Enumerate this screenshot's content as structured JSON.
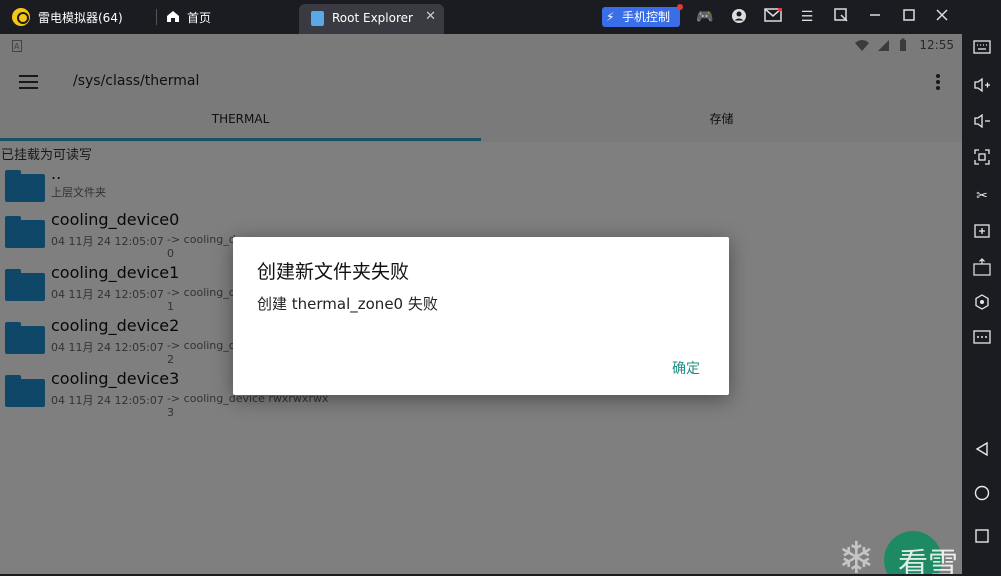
{
  "titlebar": {
    "app_name": "雷电模拟器(64)",
    "home_label": "首页",
    "tab_label": "Root Explorer",
    "tab_close": "✕",
    "phone_control": "手机控制",
    "icons": [
      "gamepad-icon",
      "user-icon",
      "mail-icon",
      "menu-icon",
      "restore-icon",
      "minimize-icon",
      "maximize-icon",
      "close-icon"
    ]
  },
  "status": {
    "time": "12:55"
  },
  "appbar": {
    "path": "/sys/class/thermal"
  },
  "tabs": [
    {
      "label": "THERMAL",
      "active": true
    },
    {
      "label": "存储",
      "active": false
    }
  ],
  "mount_note": "已挂载为可读写",
  "rows": [
    {
      "name": "..",
      "sub": "上层文件夹",
      "extra": "",
      "extra2": ""
    },
    {
      "name": "cooling_device0",
      "sub": "04 11月 24 12:05:07",
      "extra": "-> cooling_de",
      "extra2": "0"
    },
    {
      "name": "cooling_device1",
      "sub": "04 11月 24 12:05:07",
      "extra": "-> cooling_de",
      "extra2": "1"
    },
    {
      "name": "cooling_device2",
      "sub": "04 11月 24 12:05:07",
      "extra": "-> cooling_de",
      "extra2": "2"
    },
    {
      "name": "cooling_device3",
      "sub": "04 11月 24 12:05:07",
      "extra": "-> cooling_device  rwxrwxrwx",
      "extra2": "3"
    }
  ],
  "dialog": {
    "title": "创建新文件夹失败",
    "message": "创建 thermal_zone0 失败",
    "ok": "确定"
  },
  "watermark": {
    "text": "看雪"
  },
  "colors": {
    "accent": "#26a6c7",
    "folder": "#1f8fd0",
    "dialog_button": "#1e8f86"
  }
}
